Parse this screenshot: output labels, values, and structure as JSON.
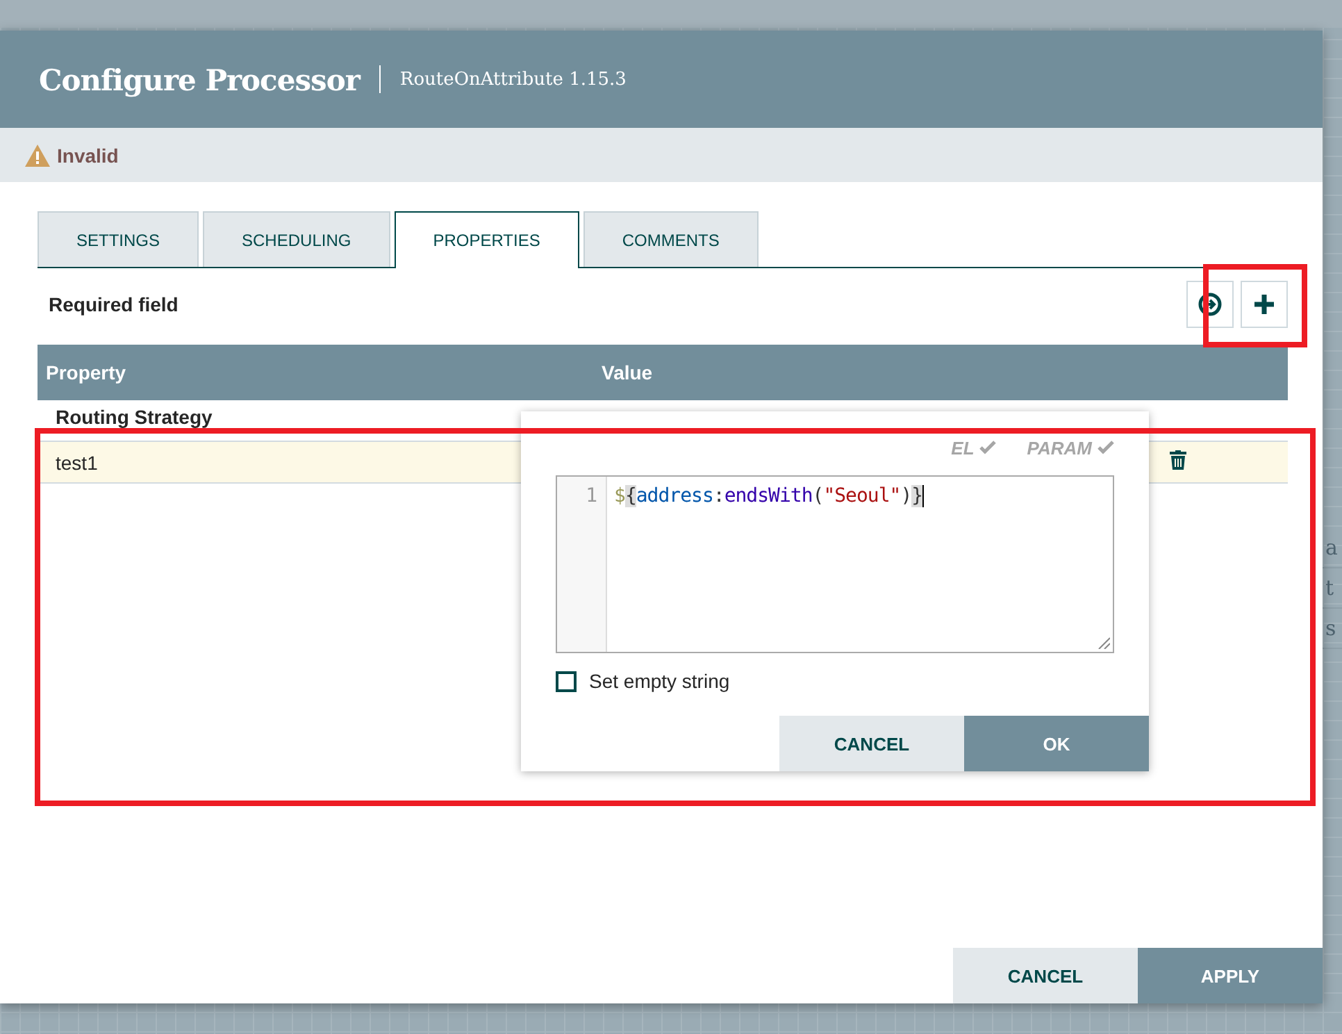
{
  "backdrop": {
    "side_texts": [
      "a",
      "t",
      "s"
    ]
  },
  "dialog": {
    "title": "Configure Processor",
    "subtitle": "RouteOnAttribute 1.15.3",
    "status": "Invalid",
    "tabs": [
      {
        "label": "SETTINGS",
        "selected": false
      },
      {
        "label": "SCHEDULING",
        "selected": false
      },
      {
        "label": "PROPERTIES",
        "selected": true
      },
      {
        "label": "COMMENTS",
        "selected": false
      }
    ],
    "required_label": "Required field",
    "table": {
      "columns": [
        "Property",
        "Value"
      ],
      "rows": [
        {
          "name": "Routing Strategy",
          "selected": false
        },
        {
          "name": "test1",
          "selected": true
        }
      ]
    },
    "buttons": [
      "CANCEL",
      "APPLY"
    ]
  },
  "editor_popup": {
    "flags": [
      "EL",
      "PARAM"
    ],
    "line_number": "1",
    "tokens": [
      {
        "text": "$",
        "kind": "sigil"
      },
      {
        "text": "{",
        "kind": "bracket"
      },
      {
        "text": "address",
        "kind": "variable"
      },
      {
        "text": ":",
        "kind": "punct"
      },
      {
        "text": "endsWith",
        "kind": "function"
      },
      {
        "text": "(",
        "kind": "punct"
      },
      {
        "text": "\"Seoul\"",
        "kind": "string"
      },
      {
        "text": ")",
        "kind": "punct"
      },
      {
        "text": "}",
        "kind": "bracket"
      }
    ],
    "empty_string": {
      "label": "Set empty string",
      "checked": false
    },
    "buttons": [
      "CANCEL",
      "OK"
    ]
  }
}
